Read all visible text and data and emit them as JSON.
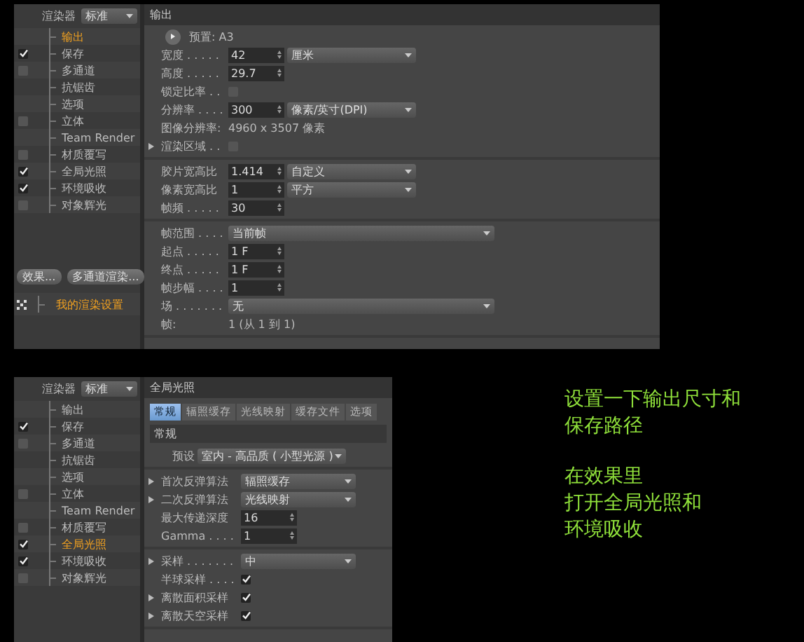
{
  "panels": [
    {
      "renderer": {
        "label": "渲染器",
        "value": "标准"
      },
      "sidebar_items": [
        {
          "label": "输出",
          "kind": "plain",
          "selected": true
        },
        {
          "label": "保存",
          "kind": "check",
          "checked": true,
          "selected": false
        },
        {
          "label": "多通道",
          "kind": "check",
          "checked": false,
          "selected": false
        },
        {
          "label": "抗锯齿",
          "kind": "plain",
          "selected": false
        },
        {
          "label": "选项",
          "kind": "plain",
          "selected": false
        },
        {
          "label": "立体",
          "kind": "check",
          "checked": false,
          "selected": false
        },
        {
          "label": "Team Render",
          "kind": "plain",
          "selected": false
        },
        {
          "label": "材质覆写",
          "kind": "check",
          "checked": false,
          "selected": false
        },
        {
          "label": "全局光照",
          "kind": "check",
          "checked": true,
          "selected": false
        },
        {
          "label": "环境吸收",
          "kind": "check",
          "checked": true,
          "selected": false
        },
        {
          "label": "对象辉光",
          "kind": "check",
          "checked": false,
          "selected": false
        }
      ],
      "buttons": [
        "效果...",
        "多通道渲染..."
      ],
      "settings_item": {
        "label": "我的渲染设置",
        "selected": true
      },
      "main": {
        "title": "输出",
        "sections": [
          {
            "rows": [
              {
                "kind": "preset-button",
                "label": "预置: A3",
                "expandable": false
              },
              {
                "kind": "field",
                "label": "宽度 . . . . .",
                "value": "42",
                "unit": "厘米",
                "expandable": false
              },
              {
                "kind": "field",
                "label": "高度 . . . . .",
                "value": "29.7",
                "expandable": false
              },
              {
                "kind": "check",
                "label": "锁定比率 . .",
                "checked": false,
                "expandable": false
              },
              {
                "kind": "field",
                "label": "分辨率 . . . .",
                "value": "300",
                "unit": "像素/英寸(DPI)",
                "expandable": false
              },
              {
                "kind": "info",
                "label": "图像分辨率:",
                "value": "4960 x 3507 像素",
                "expandable": false
              },
              {
                "kind": "check",
                "label": "渲染区域 . .",
                "checked": false,
                "expandable": true
              }
            ]
          },
          {
            "rows": [
              {
                "kind": "field",
                "label": "胶片宽高比",
                "value": "1.414",
                "unit": "自定义",
                "expandable": false
              },
              {
                "kind": "field",
                "label": "像素宽高比",
                "value": "1",
                "unit": "平方",
                "expandable": false
              },
              {
                "kind": "field",
                "label": "帧频 . . . . .",
                "value": "30",
                "expandable": false
              }
            ]
          },
          {
            "rows": [
              {
                "kind": "select",
                "label": "帧范围 . . . .",
                "value": "当前帧",
                "expandable": false
              },
              {
                "kind": "field",
                "label": "起点 . . . . .",
                "value": "1 F",
                "expandable": false
              },
              {
                "kind": "field",
                "label": "终点 . . . . .",
                "value": "1 F",
                "expandable": false
              },
              {
                "kind": "field",
                "label": "帧步幅 . . . .",
                "value": "1",
                "expandable": false
              },
              {
                "kind": "select",
                "label": "场 . . . . . . .",
                "value": "无",
                "expandable": false
              },
              {
                "kind": "info",
                "label": "帧:",
                "value": "1 (从 1 到 1)",
                "expandable": false
              }
            ]
          }
        ]
      }
    },
    {
      "renderer": {
        "label": "渲染器",
        "value": "标准"
      },
      "sidebar_items": [
        {
          "label": "输出",
          "kind": "plain",
          "selected": false
        },
        {
          "label": "保存",
          "kind": "check",
          "checked": true,
          "selected": false
        },
        {
          "label": "多通道",
          "kind": "check",
          "checked": false,
          "selected": false
        },
        {
          "label": "抗锯齿",
          "kind": "plain",
          "selected": false
        },
        {
          "label": "选项",
          "kind": "plain",
          "selected": false
        },
        {
          "label": "立体",
          "kind": "check",
          "checked": false,
          "selected": false
        },
        {
          "label": "Team Render",
          "kind": "plain",
          "selected": false
        },
        {
          "label": "材质覆写",
          "kind": "check",
          "checked": false,
          "selected": false
        },
        {
          "label": "全局光照",
          "kind": "check",
          "checked": true,
          "selected": true
        },
        {
          "label": "环境吸收",
          "kind": "check",
          "checked": true,
          "selected": false
        },
        {
          "label": "对象辉光",
          "kind": "check",
          "checked": false,
          "selected": false
        }
      ],
      "main": {
        "title": "全局光照",
        "tabs": [
          {
            "label": "常规",
            "selected": true
          },
          {
            "label": "辐照缓存",
            "selected": false
          },
          {
            "label": "光线映射",
            "selected": false
          },
          {
            "label": "缓存文件",
            "selected": false
          },
          {
            "label": "选项",
            "selected": false
          }
        ],
        "section_title": "常规",
        "sections": [
          {
            "rows": [
              {
                "kind": "preset",
                "label": "预设",
                "value": "室内 - 高品质 ( 小型光源 )",
                "expandable": false
              }
            ]
          },
          {
            "rows": [
              {
                "kind": "select",
                "label": "首次反弹算法",
                "value": "辐照缓存",
                "expandable": true
              },
              {
                "kind": "select",
                "label": "二次反弹算法",
                "value": "光线映射",
                "expandable": true
              },
              {
                "kind": "field",
                "label": "最大传递深度",
                "value": "16",
                "expandable": false
              },
              {
                "kind": "field",
                "label": "Gamma . . . .",
                "value": "1",
                "expandable": false
              }
            ]
          },
          {
            "rows": [
              {
                "kind": "select",
                "label": "采样 . . . . . . .",
                "value": "中",
                "expandable": true
              },
              {
                "kind": "check",
                "label": "半球采样 . . . .",
                "checked": true,
                "expandable": false
              },
              {
                "kind": "check",
                "label": "离散面积采样",
                "checked": true,
                "expandable": true
              },
              {
                "kind": "check",
                "label": "离散天空采样",
                "checked": true,
                "expandable": true
              }
            ]
          }
        ]
      }
    }
  ],
  "note": {
    "paragraphs": [
      [
        "设置一下输出尺寸和",
        "保存路径"
      ],
      [
        "在效果里",
        "打开全局光照和",
        "环境吸收"
      ]
    ]
  }
}
